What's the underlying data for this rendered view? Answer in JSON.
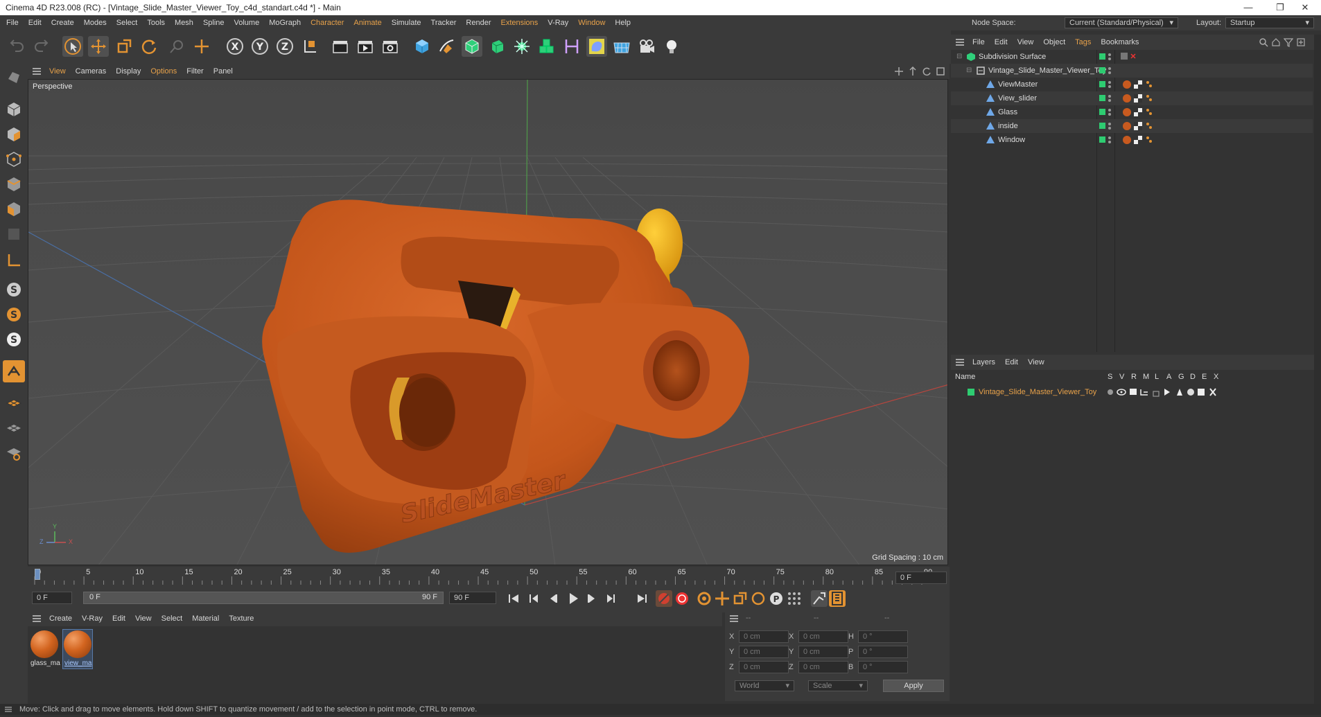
{
  "window": {
    "title": "Cinema 4D R23.008 (RC) - [Vintage_Slide_Master_Viewer_Toy_c4d_standart.c4d *] - Main",
    "minimize": "—",
    "restore": "❐",
    "close": "✕"
  },
  "menubar": {
    "items": [
      "File",
      "Edit",
      "Create",
      "Modes",
      "Select",
      "Tools",
      "Mesh",
      "Spline",
      "Volume",
      "MoGraph",
      "Character",
      "Animate",
      "Simulate",
      "Tracker",
      "Render",
      "Extensions",
      "V-Ray",
      "Window",
      "Help"
    ],
    "node_space_label": "Node Space:",
    "node_space_value": "Current (Standard/Physical)",
    "layout_label": "Layout:",
    "layout_value": "Startup"
  },
  "viewport": {
    "menu": [
      "View",
      "Cameras",
      "Display",
      "Options",
      "Filter",
      "Panel"
    ],
    "camera_label": "Perspective",
    "grid_spacing": "Grid Spacing : 10 cm",
    "axis_y": "Y",
    "axis_z": "Z",
    "axis_x": "X",
    "logo_text": "SlideMaster"
  },
  "timeline": {
    "ticks": [
      "0",
      "5",
      "10",
      "15",
      "20",
      "25",
      "30",
      "35",
      "40",
      "45",
      "50",
      "55",
      "60",
      "65",
      "70",
      "75",
      "80",
      "85",
      "90"
    ],
    "current_frame": "0 F",
    "start_field": "0 F",
    "range_start": "0 F",
    "range_end": "90 F",
    "end_field": "90 F"
  },
  "material_manager": {
    "menu": [
      "Create",
      "V-Ray",
      "Edit",
      "View",
      "Select",
      "Material",
      "Texture"
    ],
    "materials": [
      {
        "label": "glass_ma",
        "selected": false
      },
      {
        "label": "view_ma",
        "selected": true
      }
    ]
  },
  "coordinates": {
    "header_a": "--",
    "header_b": "--",
    "header_c": "--",
    "rows": [
      {
        "a_label": "X",
        "a_val": "0 cm",
        "b_label": "X",
        "b_val": "0 cm",
        "c_label": "H",
        "c_val": "0 °"
      },
      {
        "a_label": "Y",
        "a_val": "0 cm",
        "b_label": "Y",
        "b_val": "0 cm",
        "c_label": "P",
        "c_val": "0 °"
      },
      {
        "a_label": "Z",
        "a_val": "0 cm",
        "b_label": "Z",
        "b_val": "0 cm",
        "c_label": "B",
        "c_val": "0 °"
      }
    ],
    "mode_world": "World",
    "mode_scale": "Scale",
    "apply": "Apply"
  },
  "object_manager": {
    "menu": [
      "File",
      "Edit",
      "View",
      "Object",
      "Tags",
      "Bookmarks"
    ],
    "objects": [
      {
        "name": "Subdivision Surface",
        "indent": 0
      },
      {
        "name": "Vintage_Slide_Master_Viewer_Toy",
        "indent": 1
      },
      {
        "name": "ViewMaster",
        "indent": 2
      },
      {
        "name": "View_slider",
        "indent": 2
      },
      {
        "name": "Glass",
        "indent": 2
      },
      {
        "name": "inside",
        "indent": 2
      },
      {
        "name": "Window",
        "indent": 2
      }
    ]
  },
  "layers": {
    "menu": [
      "Layers",
      "Edit",
      "View"
    ],
    "columns": [
      "Name",
      "S",
      "V",
      "R",
      "M",
      "L",
      "A",
      "G",
      "D",
      "E",
      "X"
    ],
    "rows": [
      {
        "name": "Vintage_Slide_Master_Viewer_Toy",
        "color": "#2ecc71"
      }
    ]
  },
  "status": {
    "text": "Move: Click and drag to move elements. Hold down SHIFT to quantize movement / add to the selection in point mode, CTRL to remove."
  },
  "colors": {
    "accent_orange": "#e39332",
    "layer_green": "#2ecc71",
    "model_orange": "#c9581c"
  }
}
